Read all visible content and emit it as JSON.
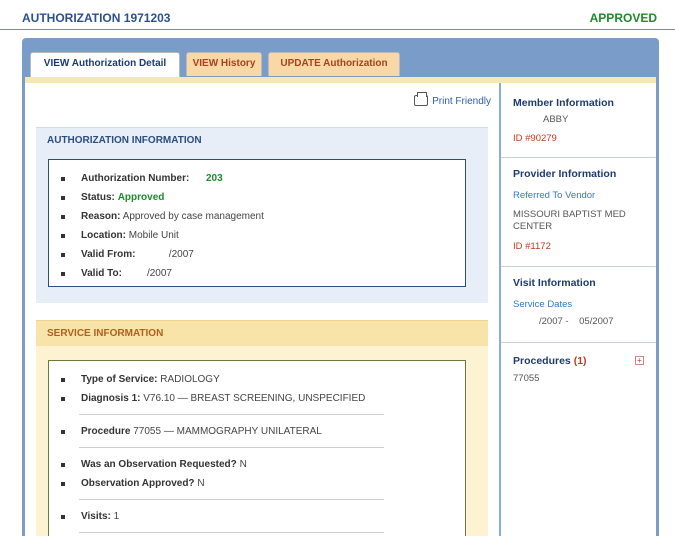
{
  "header": {
    "title": "AUTHORIZATION 1971203",
    "status": "APPROVED"
  },
  "tabs": [
    {
      "label": "VIEW Authorization Detail",
      "active": true
    },
    {
      "label": "VIEW History",
      "active": false
    },
    {
      "label": "UPDATE Authorization",
      "active": false
    }
  ],
  "print_label": "Print Friendly",
  "auth_section": {
    "title": "AUTHORIZATION INFORMATION",
    "auth_number_label": "Authorization Number:",
    "auth_number_value": "203",
    "status_label": "Status:",
    "status_value": "Approved",
    "reason_label": "Reason:",
    "reason_value": "Approved by case management",
    "location_label": "Location:",
    "location_value": "Mobile Unit",
    "valid_from_label": "Valid From:",
    "valid_from_value": "/2007",
    "valid_to_label": "Valid To:",
    "valid_to_value": "/2007"
  },
  "service_section": {
    "title": "SERVICE INFORMATION",
    "type_label": "Type of Service:",
    "type_value": "RADIOLOGY",
    "diagnosis_label": "Diagnosis 1:",
    "diagnosis_value": "V76.10 — BREAST SCREENING, UNSPECIFIED",
    "procedure_label": "Procedure",
    "procedure_value": "77055 — MAMMOGRAPHY UNILATERAL",
    "obs_requested_label": "Was an Observation Requested?",
    "obs_requested_value": "N",
    "obs_approved_label": "Observation Approved?",
    "obs_approved_value": "N",
    "visits_label": "Visits:",
    "visits_value": "1"
  },
  "sidebar": {
    "member": {
      "title": "Member Information",
      "name": "ABBY",
      "id": "ID #90279"
    },
    "provider": {
      "title": "Provider Information",
      "link": "Referred To Vendor",
      "name": "MISSOURI BAPTIST MED CENTER",
      "id": "ID #1172"
    },
    "visit": {
      "title": "Visit Information",
      "link": "Service Dates",
      "dates": "/2007 -    05/2007"
    },
    "procedures": {
      "title": "Procedures",
      "count": "(1)",
      "code": "77055"
    }
  },
  "colors": {
    "accent_blue": "#2d4f8c",
    "approved_green": "#1d8a2c",
    "tab_orange": "#f9d8a7"
  }
}
